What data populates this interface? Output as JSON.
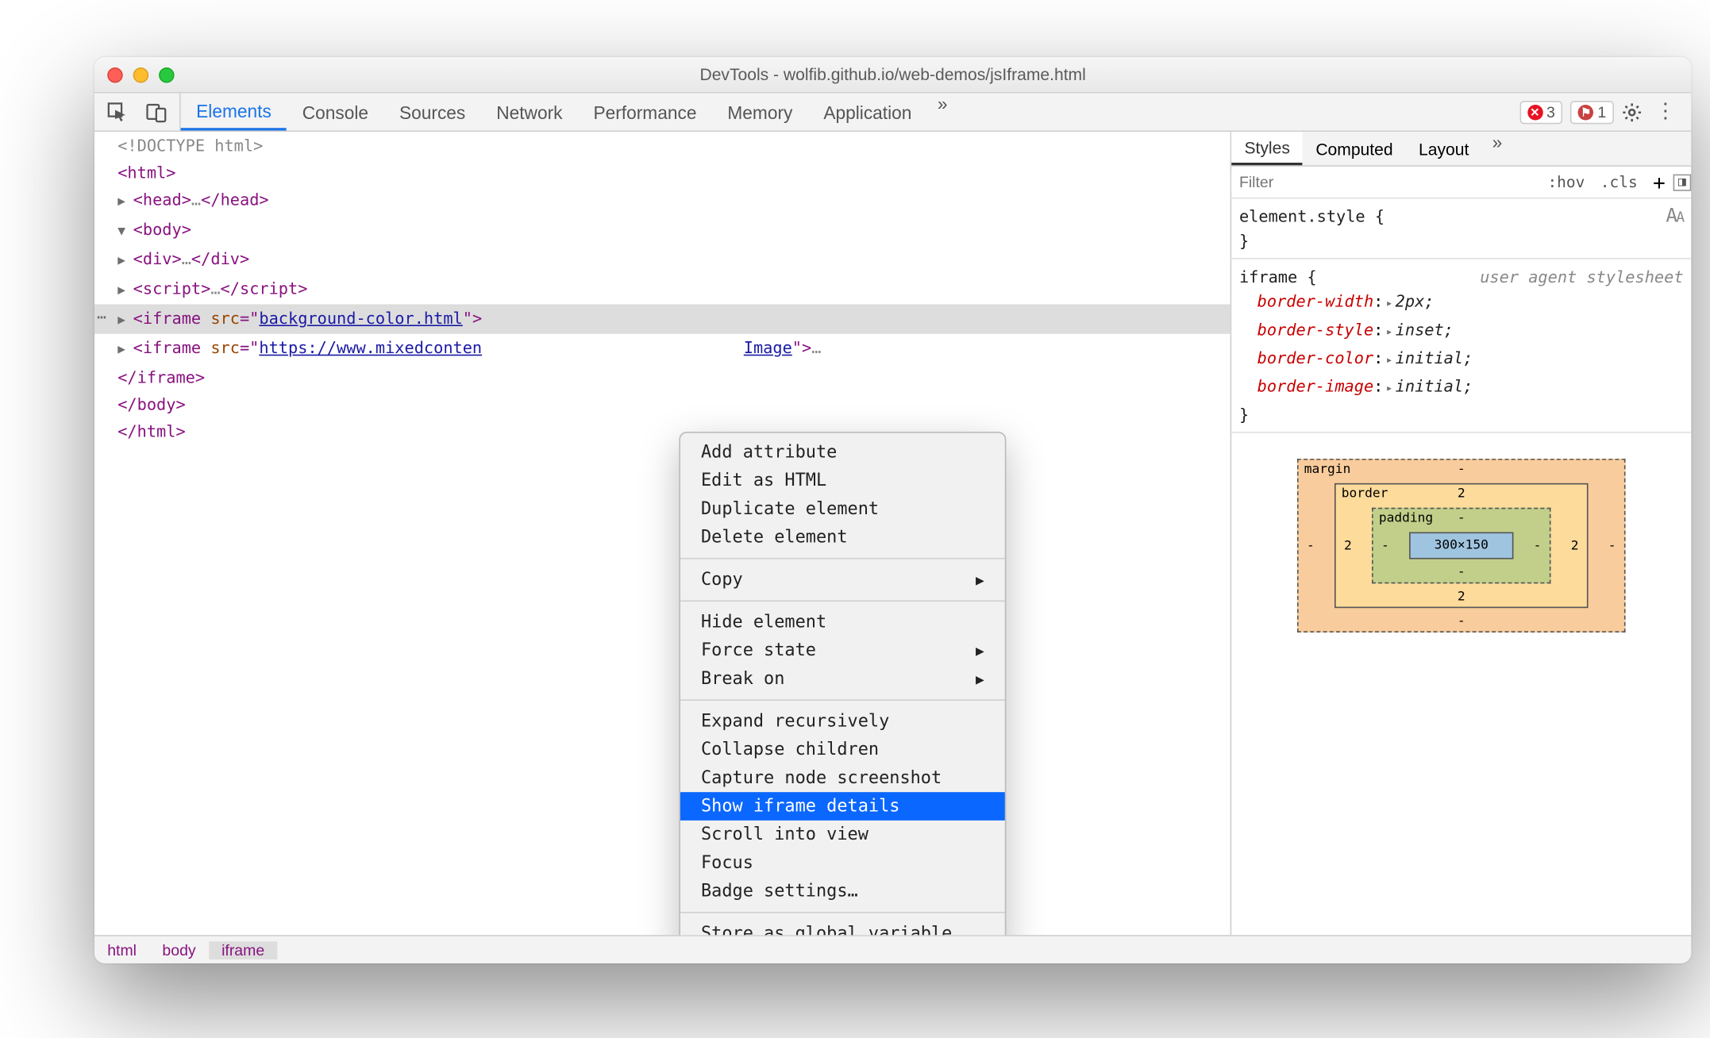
{
  "window": {
    "title": "DevTools - wolfib.github.io/web-demos/jsIframe.html"
  },
  "toolbar": {
    "tabs": [
      "Elements",
      "Console",
      "Sources",
      "Network",
      "Performance",
      "Memory",
      "Application"
    ],
    "active_tab": "Elements",
    "errors_count": "3",
    "issues_count": "1"
  },
  "dom": {
    "doctype": "<!DOCTYPE html>",
    "html_open": "html",
    "head_open": "head",
    "head_ell": "…",
    "head_close": "head",
    "body_open": "body",
    "div_open": "div",
    "div_ell": "…",
    "div_close": "div",
    "script_open": "script",
    "script_ell": "…",
    "script_close": "script",
    "iframe1_tag": "iframe",
    "iframe1_attr": "src",
    "iframe1_val": "background-color.html",
    "iframe2_tag": "iframe",
    "iframe2_attr": "src",
    "iframe2_val": "https://www.mixedconten",
    "iframe2_tail": "Image",
    "iframe2_ell": "…",
    "iframe_close": "iframe",
    "body_close": "body",
    "html_close": "html"
  },
  "breadcrumb": {
    "items": [
      "html",
      "body",
      "iframe"
    ],
    "current": "iframe"
  },
  "context_menu": {
    "items_1": [
      "Add attribute",
      "Edit as HTML",
      "Duplicate element",
      "Delete element"
    ],
    "items_2": [
      {
        "label": "Copy",
        "sub": true
      }
    ],
    "items_3": [
      {
        "label": "Hide element"
      },
      {
        "label": "Force state",
        "sub": true
      },
      {
        "label": "Break on",
        "sub": true
      }
    ],
    "items_4": [
      "Expand recursively",
      "Collapse children",
      "Capture node screenshot",
      "Show iframe details",
      "Scroll into view",
      "Focus",
      "Badge settings…"
    ],
    "items_5": [
      "Store as global variable"
    ],
    "highlighted": "Show iframe details"
  },
  "sidebar": {
    "tabs": [
      "Styles",
      "Computed",
      "Layout"
    ],
    "active": "Styles",
    "filter_placeholder": "Filter",
    "chips": [
      ":hov",
      ".cls"
    ],
    "element_style_label": "element.style {",
    "element_style_close": "}",
    "iframe_rule": "iframe {",
    "ua_note": "user agent stylesheet",
    "props": [
      {
        "name": "border-width",
        "value": "2px;"
      },
      {
        "name": "border-style",
        "value": "inset;"
      },
      {
        "name": "border-color",
        "value": "initial;"
      },
      {
        "name": "border-image",
        "value": "initial;"
      }
    ],
    "rule_close": "}"
  },
  "boxmodel": {
    "margin_label": "margin",
    "margin": {
      "t": "-",
      "r": "-",
      "b": "-",
      "l": "-"
    },
    "border_label": "border",
    "border": {
      "t": "2",
      "r": "2",
      "b": "2",
      "l": "2"
    },
    "padding_label": "padding",
    "padding": {
      "t": "-",
      "r": "-",
      "b": "-",
      "l": "-"
    },
    "content": "300×150"
  }
}
